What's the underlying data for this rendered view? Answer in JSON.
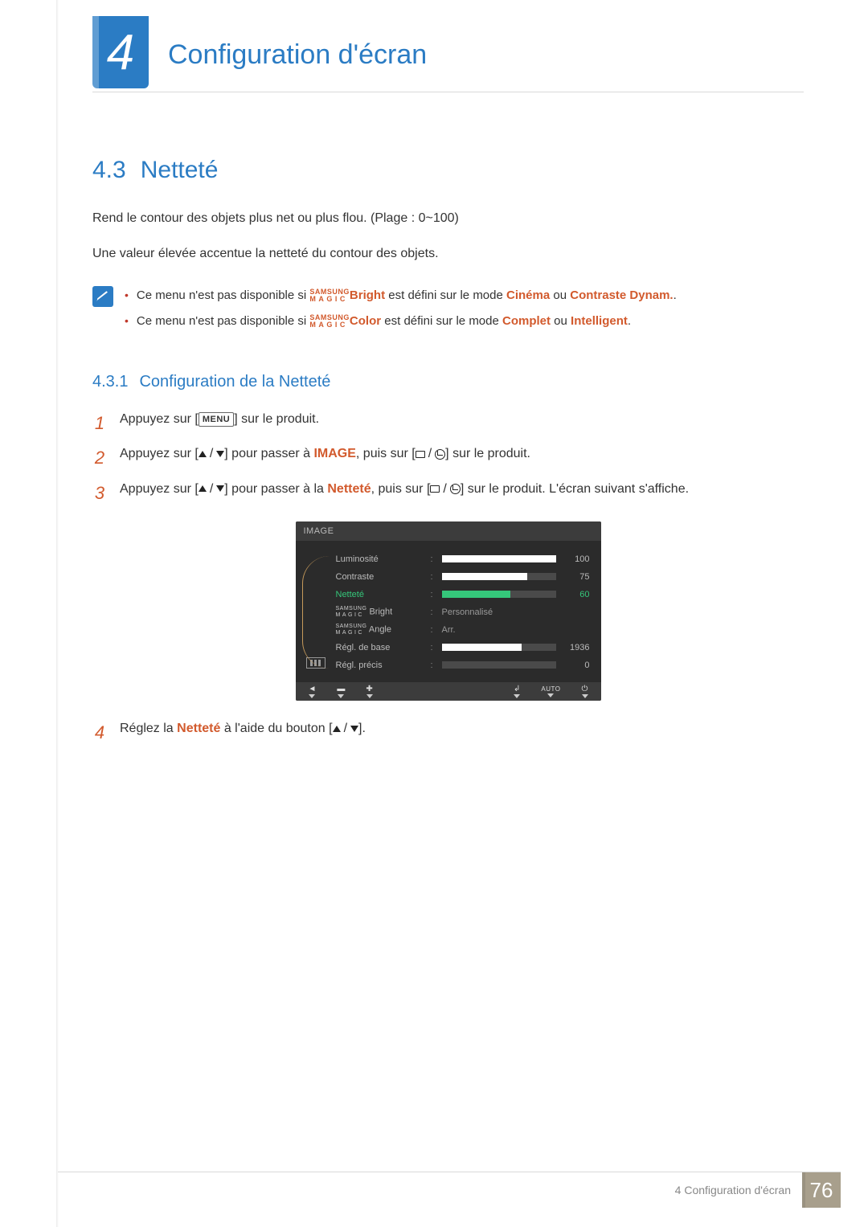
{
  "chapter": {
    "number": "4",
    "title": "Configuration d'écran"
  },
  "section": {
    "number": "4.3",
    "title": "Netteté"
  },
  "intro": [
    "Rend le contour des objets plus net ou plus flou. (Plage : 0~100)",
    "Une valeur élevée accentue la netteté du contour des objets."
  ],
  "notes": {
    "bright_prefix": "Ce menu n'est pas disponible si ",
    "bright_word": "Bright",
    "bright_mid": " est défini sur le mode ",
    "cinema": "Cinéma",
    "or": " ou ",
    "contrast_dyn": "Contraste Dynam.",
    "period": ".",
    "color_prefix": "Ce menu n'est pas disponible si ",
    "color_word": "Color",
    "color_mid": " est défini sur le mode ",
    "complete": "Complet",
    "intelligent": "Intelligent"
  },
  "subsection": {
    "number": "4.3.1",
    "title": "Configuration de la Netteté"
  },
  "steps": {
    "s1a": "Appuyez sur [",
    "menu_key": "MENU",
    "s1b": "] sur le produit.",
    "s2a": "Appuyez sur [",
    "s2b": "] pour passer à ",
    "image_word": "IMAGE",
    "s2c": ", puis sur [",
    "s2d": "] sur le produit.",
    "s3a": "Appuyez sur [",
    "s3b": "] pour passer à la ",
    "nettete_word": "Netteté",
    "s3c": ", puis sur [",
    "s3d": "] sur le produit. L'écran suivant s'affiche.",
    "s4a": "Réglez la ",
    "s4c": " à l'aide du bouton [",
    "s4d": "]."
  },
  "osd": {
    "title": "IMAGE",
    "rows": {
      "lum": {
        "label": "Luminosité",
        "value": 100,
        "pct": 100
      },
      "con": {
        "label": "Contraste",
        "value": 75,
        "pct": 75
      },
      "net": {
        "label": "Netteté",
        "value": 60,
        "pct": 60
      },
      "bright": {
        "label": "Bright",
        "value": "Personnalisé"
      },
      "angle": {
        "label": "Angle",
        "value": "Arr."
      },
      "base": {
        "label": "Régl. de base",
        "value": 1936,
        "pct": 70
      },
      "precis": {
        "label": "Régl. précis",
        "value": 0,
        "pct": 0
      }
    },
    "auto": "AUTO"
  },
  "magic": {
    "top": "SAMSUNG",
    "bottom": "MAGIC"
  },
  "footer": {
    "text": "4 Configuration d'écran",
    "page": "76"
  }
}
